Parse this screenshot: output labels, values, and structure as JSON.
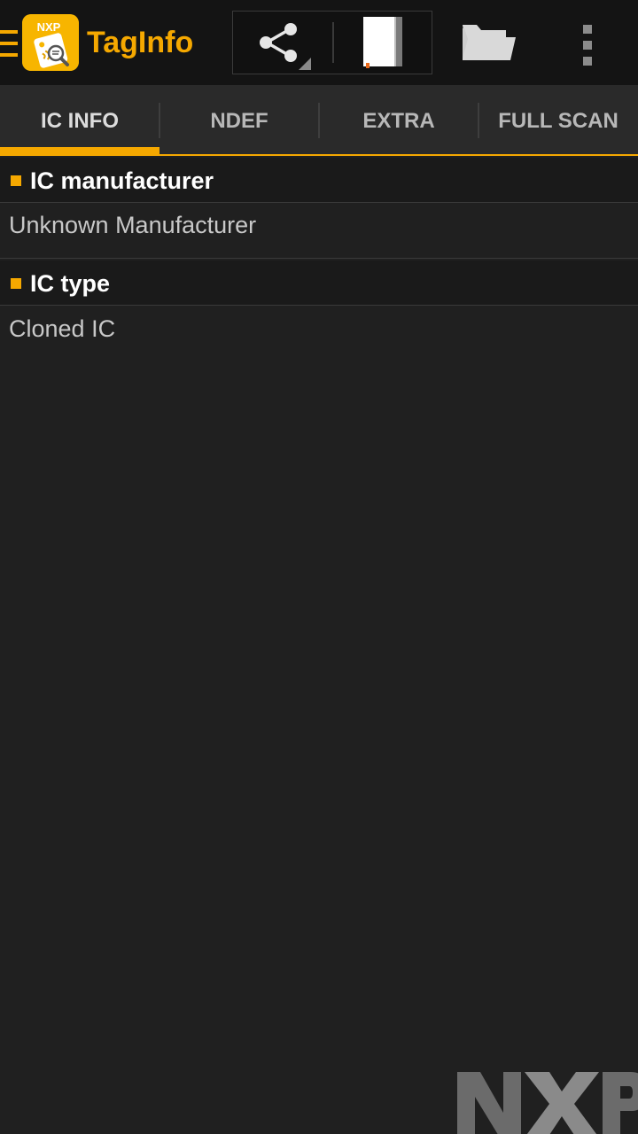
{
  "app": {
    "title": "TagInfo",
    "icon_badge": "NXP",
    "icon_name": "taginfo-app-icon",
    "accent_color": "#f5a800"
  },
  "toolbar": {
    "drawer_icon": "hamburger-menu-icon",
    "share_icon": "share-icon",
    "book_icon": "book-icon",
    "folder_icon": "folder-open-icon",
    "overflow_icon": "more-vertical-icon"
  },
  "tabs": [
    {
      "label": "IC INFO",
      "active": true
    },
    {
      "label": "NDEF",
      "active": false
    },
    {
      "label": "EXTRA",
      "active": false
    },
    {
      "label": "FULL SCAN",
      "active": false
    }
  ],
  "sections": [
    {
      "title": "IC manufacturer",
      "value": "Unknown Manufacturer"
    },
    {
      "title": "IC type",
      "value": "Cloned IC"
    }
  ],
  "watermark": {
    "text": "NXP",
    "icon_name": "nxp-logo-watermark"
  }
}
